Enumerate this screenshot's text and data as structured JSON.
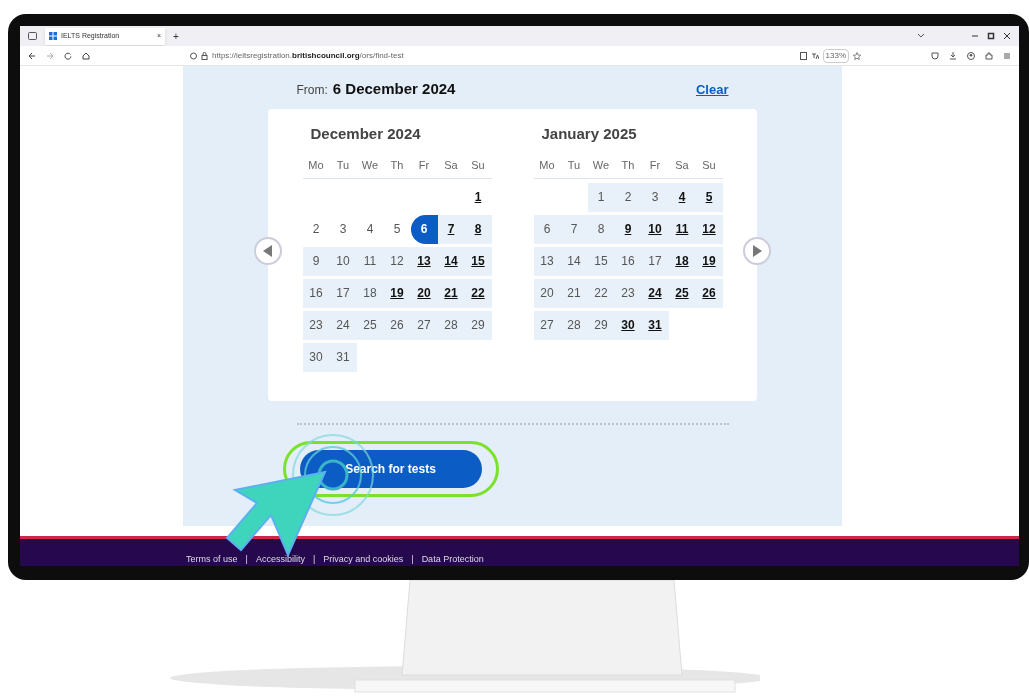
{
  "browser": {
    "tab_title": "IELTS Registration",
    "tab_close": "×",
    "new_tab": "+",
    "url_prefix": "https://ieltsregistration.",
    "url_domain": "britishcouncil.org",
    "url_path": "/ors/find-test",
    "zoom": "133%"
  },
  "page": {
    "from_label": "From:",
    "from_value": "6 December 2024",
    "clear_link": "Clear",
    "months": [
      {
        "title": "December 2024",
        "weekdays": [
          "Mo",
          "Tu",
          "We",
          "Th",
          "Fr",
          "Sa",
          "Su"
        ],
        "weeks": [
          [
            {
              "kind": "blank"
            },
            {
              "kind": "blank"
            },
            {
              "kind": "blank"
            },
            {
              "kind": "blank"
            },
            {
              "kind": "blank"
            },
            {
              "kind": "blank"
            },
            {
              "kind": "day",
              "d": "1",
              "available": true,
              "in_range": false,
              "selected": false
            }
          ],
          [
            {
              "kind": "day",
              "d": "2",
              "available": false,
              "in_range": false,
              "selected": false
            },
            {
              "kind": "day",
              "d": "3",
              "available": false,
              "in_range": false,
              "selected": false
            },
            {
              "kind": "day",
              "d": "4",
              "available": false,
              "in_range": false,
              "selected": false
            },
            {
              "kind": "day",
              "d": "5",
              "available": false,
              "in_range": false,
              "selected": false
            },
            {
              "kind": "day",
              "d": "6",
              "available": true,
              "in_range": true,
              "selected": true
            },
            {
              "kind": "day",
              "d": "7",
              "available": true,
              "in_range": true,
              "selected": false
            },
            {
              "kind": "day",
              "d": "8",
              "available": true,
              "in_range": true,
              "selected": false
            }
          ],
          [
            {
              "kind": "day",
              "d": "9",
              "available": false,
              "in_range": true,
              "selected": false
            },
            {
              "kind": "day",
              "d": "10",
              "available": false,
              "in_range": true,
              "selected": false
            },
            {
              "kind": "day",
              "d": "11",
              "available": false,
              "in_range": true,
              "selected": false
            },
            {
              "kind": "day",
              "d": "12",
              "available": false,
              "in_range": true,
              "selected": false
            },
            {
              "kind": "day",
              "d": "13",
              "available": true,
              "in_range": true,
              "selected": false
            },
            {
              "kind": "day",
              "d": "14",
              "available": true,
              "in_range": true,
              "selected": false
            },
            {
              "kind": "day",
              "d": "15",
              "available": true,
              "in_range": true,
              "selected": false
            }
          ],
          [
            {
              "kind": "day",
              "d": "16",
              "available": false,
              "in_range": true,
              "selected": false
            },
            {
              "kind": "day",
              "d": "17",
              "available": false,
              "in_range": true,
              "selected": false
            },
            {
              "kind": "day",
              "d": "18",
              "available": false,
              "in_range": true,
              "selected": false
            },
            {
              "kind": "day",
              "d": "19",
              "available": true,
              "in_range": true,
              "selected": false
            },
            {
              "kind": "day",
              "d": "20",
              "available": true,
              "in_range": true,
              "selected": false
            },
            {
              "kind": "day",
              "d": "21",
              "available": true,
              "in_range": true,
              "selected": false
            },
            {
              "kind": "day",
              "d": "22",
              "available": true,
              "in_range": true,
              "selected": false
            }
          ],
          [
            {
              "kind": "day",
              "d": "23",
              "available": false,
              "in_range": true,
              "selected": false
            },
            {
              "kind": "day",
              "d": "24",
              "available": false,
              "in_range": true,
              "selected": false
            },
            {
              "kind": "day",
              "d": "25",
              "available": false,
              "in_range": true,
              "selected": false
            },
            {
              "kind": "day",
              "d": "26",
              "available": false,
              "in_range": true,
              "selected": false
            },
            {
              "kind": "day",
              "d": "27",
              "available": false,
              "in_range": true,
              "selected": false
            },
            {
              "kind": "day",
              "d": "28",
              "available": false,
              "in_range": true,
              "selected": false
            },
            {
              "kind": "day",
              "d": "29",
              "available": false,
              "in_range": true,
              "selected": false
            }
          ],
          [
            {
              "kind": "day",
              "d": "30",
              "available": false,
              "in_range": true,
              "selected": false
            },
            {
              "kind": "day",
              "d": "31",
              "available": false,
              "in_range": true,
              "selected": false
            }
          ]
        ]
      },
      {
        "title": "January 2025",
        "weekdays": [
          "Mo",
          "Tu",
          "We",
          "Th",
          "Fr",
          "Sa",
          "Su"
        ],
        "weeks": [
          [
            {
              "kind": "blank"
            },
            {
              "kind": "blank"
            },
            {
              "kind": "day",
              "d": "1",
              "available": false,
              "in_range": true,
              "selected": false
            },
            {
              "kind": "day",
              "d": "2",
              "available": false,
              "in_range": true,
              "selected": false
            },
            {
              "kind": "day",
              "d": "3",
              "available": false,
              "in_range": true,
              "selected": false
            },
            {
              "kind": "day",
              "d": "4",
              "available": true,
              "in_range": true,
              "selected": false
            },
            {
              "kind": "day",
              "d": "5",
              "available": true,
              "in_range": true,
              "selected": false
            }
          ],
          [
            {
              "kind": "day",
              "d": "6",
              "available": false,
              "in_range": true,
              "selected": false
            },
            {
              "kind": "day",
              "d": "7",
              "available": false,
              "in_range": true,
              "selected": false
            },
            {
              "kind": "day",
              "d": "8",
              "available": false,
              "in_range": true,
              "selected": false
            },
            {
              "kind": "day",
              "d": "9",
              "available": true,
              "in_range": true,
              "selected": false
            },
            {
              "kind": "day",
              "d": "10",
              "available": true,
              "in_range": true,
              "selected": false
            },
            {
              "kind": "day",
              "d": "11",
              "available": true,
              "in_range": true,
              "selected": false
            },
            {
              "kind": "day",
              "d": "12",
              "available": true,
              "in_range": true,
              "selected": false
            }
          ],
          [
            {
              "kind": "day",
              "d": "13",
              "available": false,
              "in_range": true,
              "selected": false
            },
            {
              "kind": "day",
              "d": "14",
              "available": false,
              "in_range": true,
              "selected": false
            },
            {
              "kind": "day",
              "d": "15",
              "available": false,
              "in_range": true,
              "selected": false
            },
            {
              "kind": "day",
              "d": "16",
              "available": false,
              "in_range": true,
              "selected": false
            },
            {
              "kind": "day",
              "d": "17",
              "available": false,
              "in_range": true,
              "selected": false
            },
            {
              "kind": "day",
              "d": "18",
              "available": true,
              "in_range": true,
              "selected": false
            },
            {
              "kind": "day",
              "d": "19",
              "available": true,
              "in_range": true,
              "selected": false
            }
          ],
          [
            {
              "kind": "day",
              "d": "20",
              "available": false,
              "in_range": true,
              "selected": false
            },
            {
              "kind": "day",
              "d": "21",
              "available": false,
              "in_range": true,
              "selected": false
            },
            {
              "kind": "day",
              "d": "22",
              "available": false,
              "in_range": true,
              "selected": false
            },
            {
              "kind": "day",
              "d": "23",
              "available": false,
              "in_range": true,
              "selected": false
            },
            {
              "kind": "day",
              "d": "24",
              "available": true,
              "in_range": true,
              "selected": false
            },
            {
              "kind": "day",
              "d": "25",
              "available": true,
              "in_range": true,
              "selected": false
            },
            {
              "kind": "day",
              "d": "26",
              "available": true,
              "in_range": true,
              "selected": false
            }
          ],
          [
            {
              "kind": "day",
              "d": "27",
              "available": false,
              "in_range": true,
              "selected": false
            },
            {
              "kind": "day",
              "d": "28",
              "available": false,
              "in_range": true,
              "selected": false
            },
            {
              "kind": "day",
              "d": "29",
              "available": false,
              "in_range": true,
              "selected": false
            },
            {
              "kind": "day",
              "d": "30",
              "available": true,
              "in_range": true,
              "selected": false
            },
            {
              "kind": "day",
              "d": "31",
              "available": true,
              "in_range": true,
              "selected": false
            }
          ]
        ]
      }
    ],
    "search_button": "Search for tests"
  },
  "footer": {
    "links": [
      "Terms of use",
      "Accessibility",
      "Privacy and cookies",
      "Data Protection"
    ],
    "separator": "|"
  }
}
